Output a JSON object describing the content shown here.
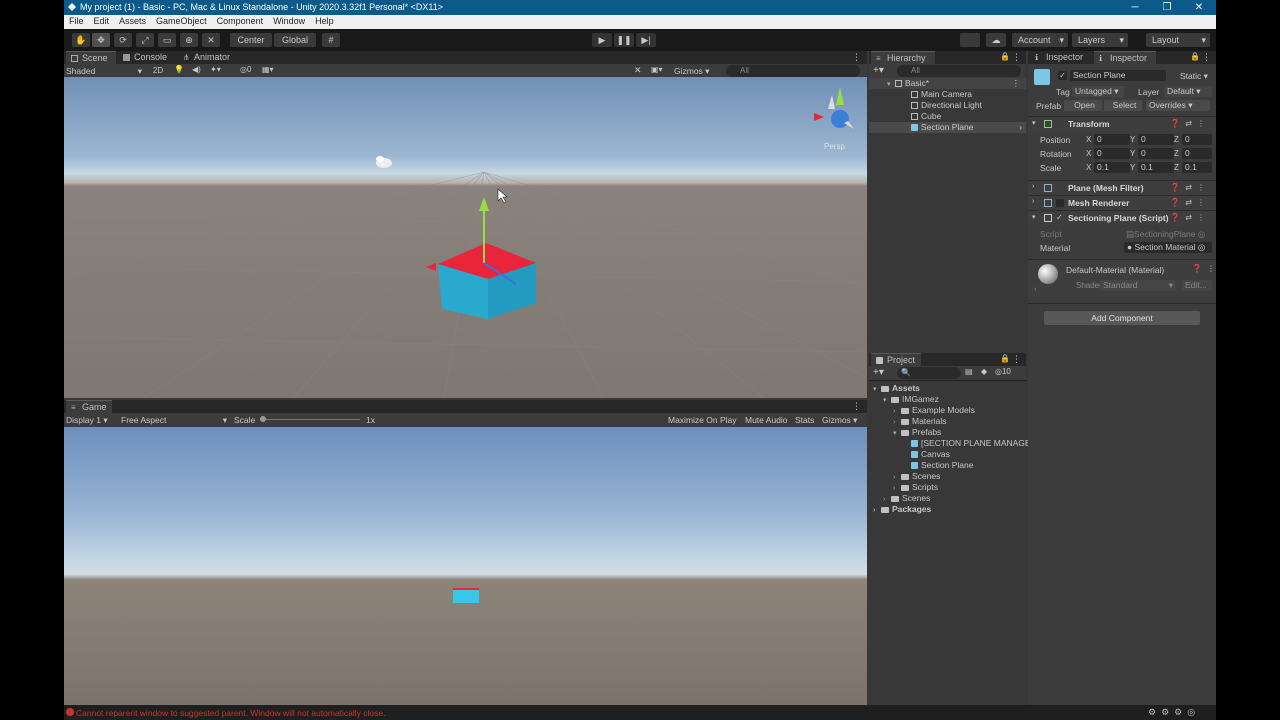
{
  "window": {
    "title": "My project (1) - Basic - PC, Mac & Linux Standalone - Unity 2020.3.32f1 Personal* <DX11>",
    "minimize": "─",
    "maximize": "❐",
    "close": "✕"
  },
  "menu": [
    "File",
    "Edit",
    "Assets",
    "GameObject",
    "Component",
    "Window",
    "Help"
  ],
  "toolbar": {
    "pivot": "Center",
    "space": "Global",
    "account": "Account",
    "layers": "Layers",
    "layout": "Layout"
  },
  "scene": {
    "tabs": [
      "Scene",
      "Console",
      "Animator"
    ],
    "shading": "Shaded",
    "mode2d": "2D",
    "hidden_count": "0",
    "gizmos": "Gizmos",
    "search_placeholder": "All",
    "gizmo_label": "Persp"
  },
  "game": {
    "tab": "Game",
    "display": "Display 1",
    "aspect": "Free Aspect",
    "scale_label": "Scale",
    "scale_value": "1x",
    "maximize": "Maximize On Play",
    "mute": "Mute Audio",
    "stats": "Stats",
    "gizmos": "Gizmos"
  },
  "hierarchy": {
    "tab": "Hierarchy",
    "search_placeholder": "All",
    "scene": "Basic*",
    "items": [
      "Main Camera",
      "Directional Light",
      "Cube",
      "Section Plane"
    ]
  },
  "project": {
    "tab": "Project",
    "hidden_count": "10",
    "tree": {
      "assets": "Assets",
      "imgamez": "IMGamez",
      "example_models": "Example Models",
      "materials": "Materials",
      "prefabs": "Prefabs",
      "section_plane_manager": "[SECTION PLANE MANAGE",
      "canvas": "Canvas",
      "section_plane": "Section Plane",
      "scenes_inner": "Scenes",
      "scripts": "Scripts",
      "scenes_outer": "Scenes",
      "packages": "Packages"
    }
  },
  "inspector": {
    "tabs": [
      "Inspector",
      "Inspector"
    ],
    "object_name": "Section Plane",
    "static": "Static",
    "tag_label": "Tag",
    "tag": "Untagged",
    "layer_label": "Layer",
    "layer": "Default",
    "prefab_label": "Prefab",
    "prefab_open": "Open",
    "prefab_select": "Select",
    "prefab_overrides": "Overrides",
    "transform": {
      "title": "Transform",
      "position_label": "Position",
      "rotation_label": "Rotation",
      "scale_label": "Scale",
      "position": {
        "x": "0",
        "y": "0",
        "z": "0"
      },
      "rotation": {
        "x": "0",
        "y": "0",
        "z": "0"
      },
      "scale": {
        "x": "0.1",
        "y": "0.1",
        "z": "0.1"
      }
    },
    "mesh_filter": "Plane (Mesh Filter)",
    "mesh_renderer": "Mesh Renderer",
    "script_component": "Sectioning Plane (Script)",
    "script_label": "Script",
    "script_value": "SectioningPlane",
    "material_label": "Material",
    "material_value": "Section Material",
    "default_material": "Default-Material (Material)",
    "shader_label": "Shader",
    "shader_value": "Standard",
    "edit": "Edit...",
    "add_component": "Add Component"
  },
  "status": {
    "message": "Cannot reparent window to suggested parent. Window will not automatically close."
  },
  "colors": {
    "accent_blue": "#0c5a8a",
    "cube_top": "#e8253a",
    "cube_side": "#2aa9cf",
    "error": "#cc3333"
  }
}
